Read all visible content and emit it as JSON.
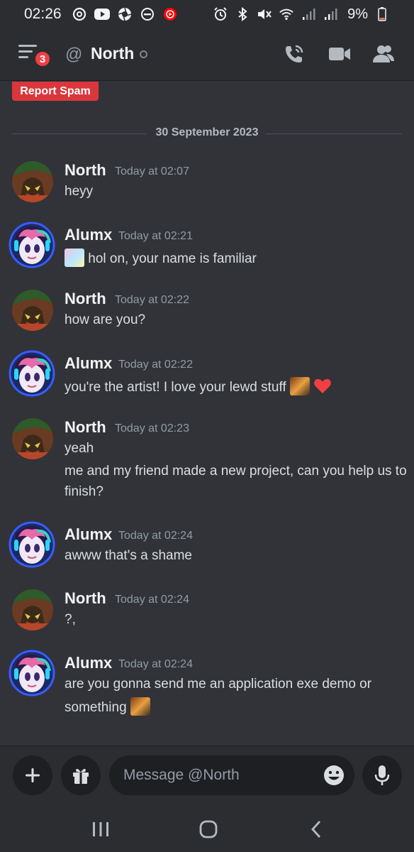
{
  "status_bar": {
    "time": "02:26",
    "battery": "9%",
    "left_icons": [
      "threads-icon",
      "youtube-icon",
      "aperture-icon",
      "do-not-disturb-icon",
      "youtube-music-icon"
    ],
    "right_icons": [
      "alarm-icon",
      "bluetooth-icon",
      "mute-icon",
      "wifi-icon",
      "signal-icon",
      "signal-icon-2",
      "battery-icon"
    ]
  },
  "header": {
    "title": "North",
    "badge_count": "3",
    "at_symbol": "@"
  },
  "report_spam_label": "Report Spam",
  "date_divider": "30 September 2023",
  "messages": [
    {
      "author": "North",
      "timestamp": "Today at 02:07",
      "lines": [
        "heyy"
      ]
    },
    {
      "author": "Alumx",
      "timestamp": "Today at 02:21",
      "lines": [
        "hol on, your name is familiar"
      ]
    },
    {
      "author": "North",
      "timestamp": "Today at 02:22",
      "lines": [
        "how are you?"
      ]
    },
    {
      "author": "Alumx",
      "timestamp": "Today at 02:22",
      "lines": [
        "you're the artist! I love your lewd stuff"
      ]
    },
    {
      "author": "North",
      "timestamp": "Today at 02:23",
      "lines": [
        "yeah",
        "me and my friend made a new project, can you help us to",
        "finish?"
      ]
    },
    {
      "author": "Alumx",
      "timestamp": "Today at 02:24",
      "lines": [
        "awww that's a shame"
      ]
    },
    {
      "author": "North",
      "timestamp": "Today at 02:24",
      "lines": [
        "?,"
      ]
    },
    {
      "author": "Alumx",
      "timestamp": "Today at 02:24",
      "lines": [
        "are you gonna send me an application exe demo or",
        "something"
      ]
    }
  ],
  "composer": {
    "placeholder": "Message @North"
  },
  "colors": {
    "background": "#313338",
    "header": "#2b2d31",
    "report_red": "#da373c",
    "badge_red": "#f23f43",
    "heart_red": "#f23f43"
  }
}
